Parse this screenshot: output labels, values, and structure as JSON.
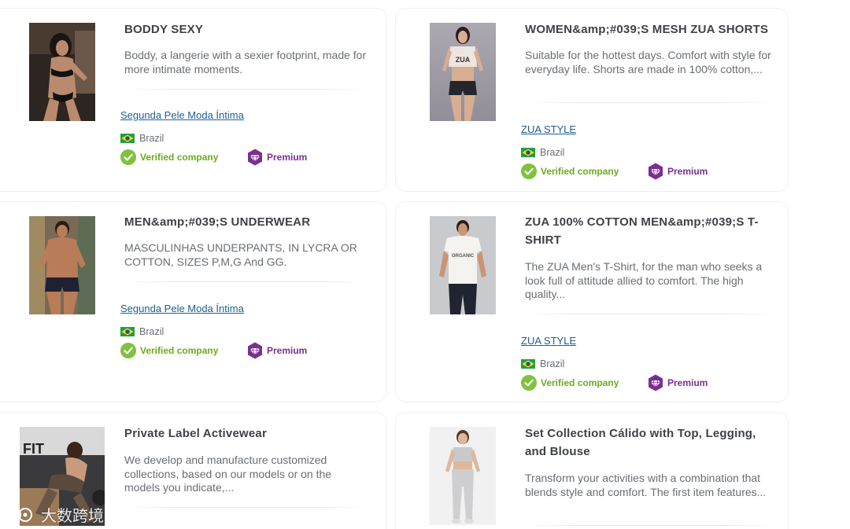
{
  "products": [
    {
      "title": "BODDY SEXY",
      "description": "Boddy, a langerie with a sexier footprint, made for more intimate moments.",
      "company": "Segunda Pele Moda Íntima",
      "country": "Brazil",
      "verified_label": "Verified company",
      "premium_label": "Premium"
    },
    {
      "title": "WOMEN&amp;#039;S MESH ZUA SHORTS",
      "description": "Suitable for the hottest days. Comfort with style for everyday life. Shorts are made in 100% cotton,...",
      "company": "ZUA STYLE",
      "country": "Brazil",
      "verified_label": "Verified company",
      "premium_label": "Premium"
    },
    {
      "title": "MEN&amp;#039;S UNDERWEAR",
      "description": "MASCULINHAS UNDERPANTS, IN LYCRA OR COTTON, SIZES P,M,G And GG.",
      "company": "Segunda Pele Moda Íntima",
      "country": "Brazil",
      "verified_label": "Verified company",
      "premium_label": "Premium"
    },
    {
      "title": "ZUA 100% COTTON MEN&amp;#039;S T-SHIRT",
      "description": "The ZUA Men's T-Shirt, for the man who seeks a look full of attitude allied to comfort. The high quality...",
      "company": "ZUA STYLE",
      "country": "Brazil",
      "verified_label": "Verified company",
      "premium_label": "Premium"
    },
    {
      "title": "Private Label Activewear",
      "description": "We develop and manufacture customized collections, based on our models or on the models you indicate,..."
    },
    {
      "title": "Set Collection Cálido with Top, Legging, and Blouse",
      "description": "Transform your activities with a combination that blends style and comfort. The first item features..."
    }
  ],
  "images": {
    "shirt_print": "ORGANIC",
    "gym_sign": "FIT"
  },
  "watermark": "大数跨境",
  "colors": {
    "title": "#3f4246",
    "description": "#6a6e73",
    "company_link": "#1d5f91",
    "verified": "#6aab1f",
    "premium": "#7b2f8f"
  },
  "icons": [
    "brazil-flag-icon",
    "verified-check-icon",
    "premium-diamond-icon"
  ]
}
